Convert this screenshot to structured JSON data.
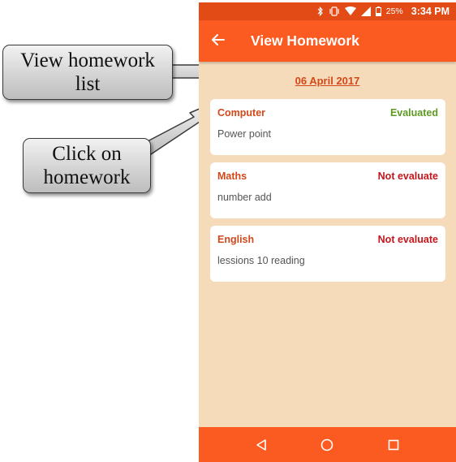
{
  "callouts": {
    "list_label": "View homework\nlist",
    "click_label": "Click on\nhomework"
  },
  "status_bar": {
    "battery_percent": "25%",
    "time": "3:34 PM",
    "icons": [
      "bluetooth-icon",
      "vibrate-icon",
      "wifi-icon",
      "signal-icon",
      "battery-icon"
    ]
  },
  "app_bar": {
    "back_icon": "back-arrow-icon",
    "title": "View Homework"
  },
  "date": "06 April 2017",
  "homework": [
    {
      "subject": "Computer",
      "status": "Evaluated",
      "status_color": "#5c9a22",
      "description": "Power point"
    },
    {
      "subject": "Maths",
      "status": "Not evaluate",
      "status_color": "#c4161c",
      "description": "number add"
    },
    {
      "subject": "English",
      "status": "Not evaluate",
      "status_color": "#c4161c",
      "description": "lessions 10 reading"
    }
  ],
  "colors": {
    "status_bar": "#e24a16",
    "app_bar": "#fb5b20",
    "background": "#f5dbba",
    "subject": "#d2481b"
  },
  "nav_bar": {
    "icons": [
      "back-triangle-icon",
      "home-circle-icon",
      "recents-square-icon"
    ]
  }
}
